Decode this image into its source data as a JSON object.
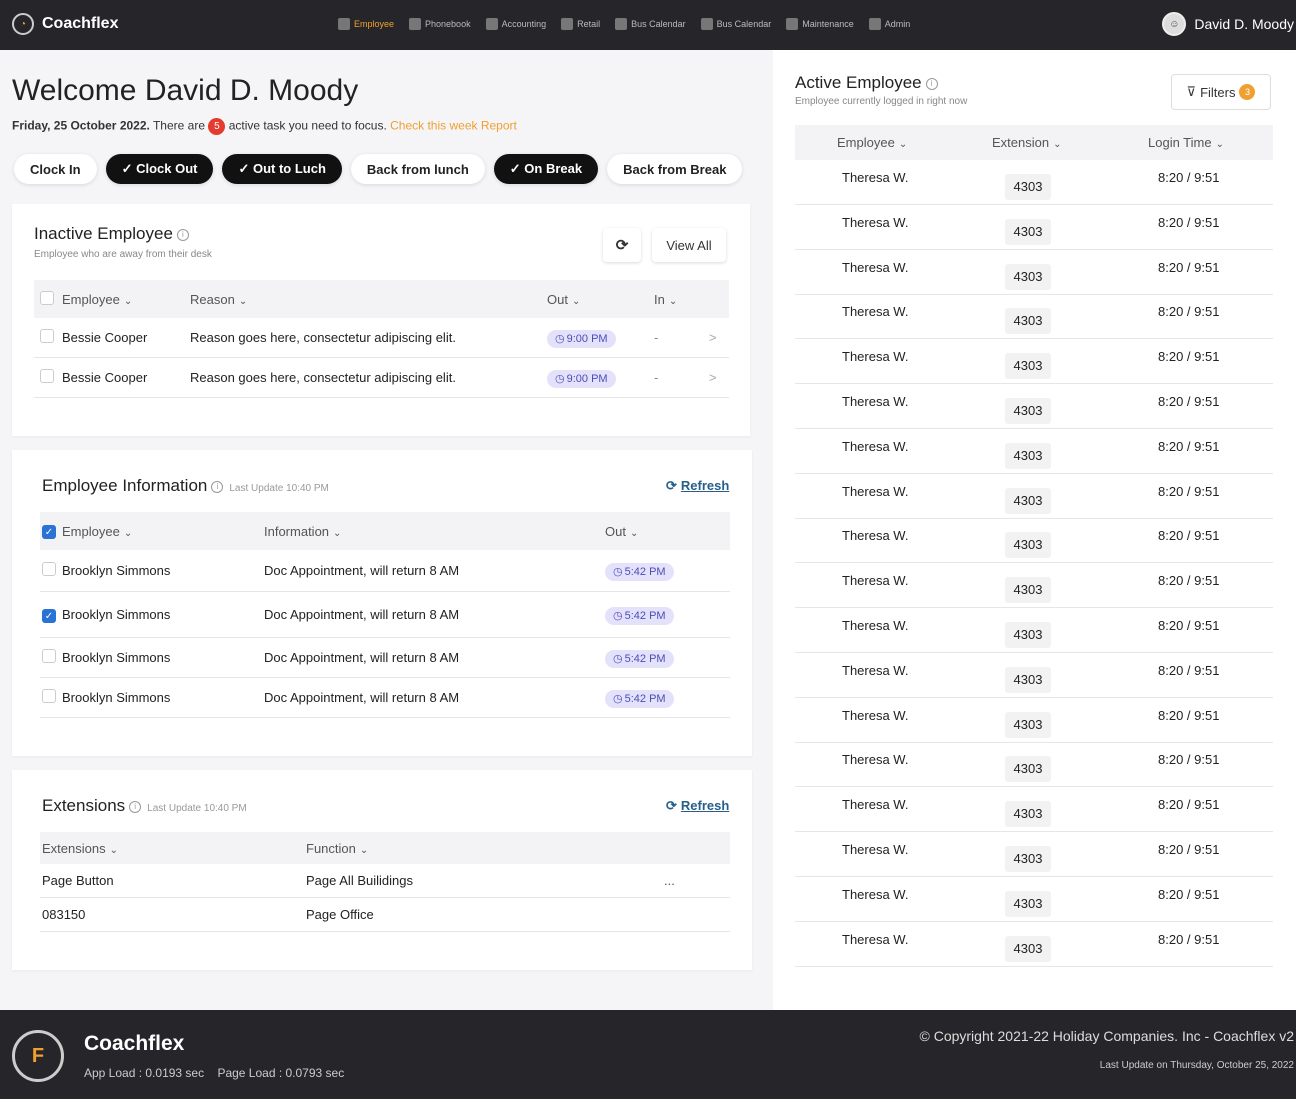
{
  "app": {
    "name": "Coachflex"
  },
  "nav": [
    "Employee",
    "Phonebook",
    "Accounting",
    "Retail",
    "Bus Calendar",
    "Bus Calendar",
    "Maintenance",
    "Admin"
  ],
  "user": {
    "name": "David D. Moody"
  },
  "welcome": {
    "title": "Welcome David D. Moody",
    "date": "Friday, 25 October 2022.",
    "text_before": "There are",
    "task_count": "5",
    "text_after": "active task you need to focus.",
    "report_link": "Check this week Report"
  },
  "buttons": [
    {
      "label": "Clock In",
      "style": "light"
    },
    {
      "label": "✓ Clock Out",
      "style": "dark"
    },
    {
      "label": "✓ Out to Luch",
      "style": "dark"
    },
    {
      "label": "Back from lunch",
      "style": "light"
    },
    {
      "label": "✓ On Break",
      "style": "dark"
    },
    {
      "label": "Back from Break",
      "style": "light"
    }
  ],
  "inactive": {
    "title": "Inactive Employee",
    "subtitle": "Employee who are away from their desk",
    "view_all": "View All",
    "headers": [
      "Employee",
      "Reason",
      "Out",
      "In"
    ],
    "rows": [
      {
        "name": "Bessie Cooper",
        "reason": "Reason goes here, consectetur adipiscing elit.",
        "out": "9:00 PM",
        "in": "-"
      },
      {
        "name": "Bessie Cooper",
        "reason": "Reason goes here, consectetur adipiscing elit.",
        "out": "9:00 PM",
        "in": "-"
      }
    ]
  },
  "info": {
    "title": "Employee Information",
    "updated": "Last Update 10:40 PM",
    "refresh": "Refresh",
    "headers": [
      "Employee",
      "Information",
      "Out"
    ],
    "rows": [
      {
        "name": "Brooklyn Simmons",
        "info": "Doc Appointment, will return 8 AM",
        "out": "5:42 PM",
        "checked": false
      },
      {
        "name": "Brooklyn Simmons",
        "info": "Doc Appointment, will return 8 AM",
        "out": "5:42 PM",
        "checked": true
      },
      {
        "name": "Brooklyn Simmons",
        "info": "Doc Appointment, will return 8 AM",
        "out": "5:42 PM",
        "checked": false
      },
      {
        "name": "Brooklyn Simmons",
        "info": "Doc Appointment, will return 8 AM",
        "out": "5:42 PM",
        "checked": false
      }
    ]
  },
  "extensions": {
    "title": "Extensions",
    "updated": "Last Update 10:40 PM",
    "refresh": "Refresh",
    "headers": [
      "Extensions",
      "Function"
    ],
    "rows": [
      {
        "ext": "Page Button",
        "func": "Page All Builidings",
        "more": "..."
      },
      {
        "ext": "083150",
        "func": "Page Office",
        "more": ""
      }
    ]
  },
  "active": {
    "title": "Active Employee",
    "subtitle": "Employee currently logged in right now",
    "filters_label": "Filters",
    "filters_count": "3",
    "headers": [
      "Employee",
      "Extension",
      "Login Time"
    ],
    "rows": [
      {
        "name": "Theresa W.",
        "ext": "4303",
        "time": "8:20 / 9:51"
      },
      {
        "name": "Theresa W.",
        "ext": "4303",
        "time": "8:20 / 9:51"
      },
      {
        "name": "Theresa W.",
        "ext": "4303",
        "time": "8:20 / 9:51"
      },
      {
        "name": "Theresa W.",
        "ext": "4303",
        "time": "8:20 / 9:51"
      },
      {
        "name": "Theresa W.",
        "ext": "4303",
        "time": "8:20 / 9:51"
      },
      {
        "name": "Theresa W.",
        "ext": "4303",
        "time": "8:20 / 9:51"
      },
      {
        "name": "Theresa W.",
        "ext": "4303",
        "time": "8:20 / 9:51"
      },
      {
        "name": "Theresa W.",
        "ext": "4303",
        "time": "8:20 / 9:51"
      },
      {
        "name": "Theresa W.",
        "ext": "4303",
        "time": "8:20 / 9:51"
      },
      {
        "name": "Theresa W.",
        "ext": "4303",
        "time": "8:20 / 9:51"
      },
      {
        "name": "Theresa W.",
        "ext": "4303",
        "time": "8:20 / 9:51"
      },
      {
        "name": "Theresa W.",
        "ext": "4303",
        "time": "8:20 / 9:51"
      },
      {
        "name": "Theresa W.",
        "ext": "4303",
        "time": "8:20 / 9:51"
      },
      {
        "name": "Theresa W.",
        "ext": "4303",
        "time": "8:20 / 9:51"
      },
      {
        "name": "Theresa W.",
        "ext": "4303",
        "time": "8:20 / 9:51"
      },
      {
        "name": "Theresa W.",
        "ext": "4303",
        "time": "8:20 / 9:51"
      },
      {
        "name": "Theresa W.",
        "ext": "4303",
        "time": "8:20 / 9:51"
      },
      {
        "name": "Theresa W.",
        "ext": "4303",
        "time": "8:20 / 9:51"
      }
    ]
  },
  "footer": {
    "name": "Coachflex",
    "app_load": "App Load : 0.0193 sec",
    "page_load": "Page Load : 0.0793 sec",
    "copyright": "© Copyright 2021-22 Holiday Companies. Inc - Coachflex v2",
    "last_update": "Last Update on Thursday, October 25, 2022"
  }
}
